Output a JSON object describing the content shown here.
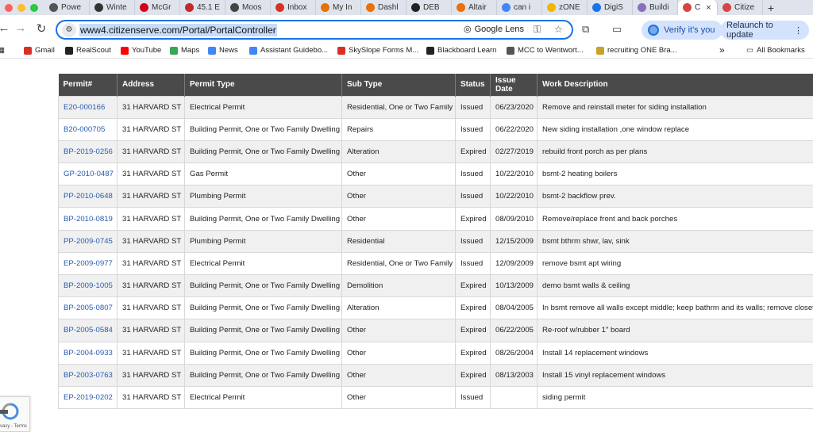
{
  "browser": {
    "tabs": [
      {
        "label": "Powe",
        "icon": "globe-icon",
        "color": "#555555"
      },
      {
        "label": "Winte",
        "icon": "s-icon",
        "color": "#333333"
      },
      {
        "label": "McGr",
        "icon": "mcgraw-icon",
        "color": "#d0021b"
      },
      {
        "label": "45.1 E",
        "icon": "red-badge-icon",
        "color": "#c62828"
      },
      {
        "label": "Moos",
        "icon": "moose-icon",
        "color": "#444444"
      },
      {
        "label": "Inbox",
        "icon": "gmail-icon",
        "color": "#d93025"
      },
      {
        "label": "My In",
        "icon": "rainbow-icon",
        "color": "#e8710a"
      },
      {
        "label": "Dashl",
        "icon": "rainbow-icon",
        "color": "#e8710a"
      },
      {
        "label": "DEB",
        "icon": "deb-icon",
        "color": "#222222"
      },
      {
        "label": "Altair",
        "icon": "rainbow-icon",
        "color": "#e8710a"
      },
      {
        "label": "can i",
        "icon": "google-icon",
        "color": "#4285f4"
      },
      {
        "label": "zONE",
        "icon": "zone-icon",
        "color": "#f4b400"
      },
      {
        "label": "DigiS",
        "icon": "digis-icon",
        "color": "#1a73e8"
      },
      {
        "label": "Buildi",
        "icon": "buildi-icon",
        "color": "#8a6fc0"
      },
      {
        "label": "C",
        "icon": "citizenserve-icon",
        "color": "#d64545",
        "active": true
      },
      {
        "label": "Citize",
        "icon": "citizenserve-icon",
        "color": "#d64545"
      }
    ],
    "new_tab": "+",
    "close_glyph": "×",
    "url": "www4.citizenserve.com/Portal/PortalController",
    "lens_label": "Google Lens",
    "verify_label": "Verify it's you",
    "relaunch_label": "Relaunch to update",
    "bookmarks": [
      {
        "label": "Gmail",
        "icon": "gmail-icon",
        "color": "#d93025"
      },
      {
        "label": "RealScout",
        "icon": "realscout-icon",
        "color": "#222222"
      },
      {
        "label": "YouTube",
        "icon": "youtube-icon",
        "color": "#ff0000"
      },
      {
        "label": "Maps",
        "icon": "maps-icon",
        "color": "#34a853"
      },
      {
        "label": "News",
        "icon": "news-icon",
        "color": "#4285f4"
      },
      {
        "label": "Assistant Guidebo...",
        "icon": "doc-icon",
        "color": "#4285f4"
      },
      {
        "label": "SkySlope Forms M...",
        "icon": "skyslope-icon",
        "color": "#d93025"
      },
      {
        "label": "Blackboard Learn",
        "icon": "blackboard-icon",
        "color": "#222222"
      },
      {
        "label": "MCC to Wentwort...",
        "icon": "globe-icon",
        "color": "#555555"
      },
      {
        "label": "recruiting ONE Bra...",
        "icon": "one-icon",
        "color": "#c9a227"
      }
    ],
    "more_glyph": "»",
    "all_bookmarks": "All Bookmarks"
  },
  "table": {
    "headers": [
      "Permit#",
      "Address",
      "Permit Type",
      "Sub Type",
      "Status",
      "Issue Date",
      "Work Description"
    ],
    "rows": [
      [
        "E20-000166",
        "31 HARVARD ST",
        "Electrical Permit",
        "Residential, One or Two Family",
        "Issued",
        "06/23/2020",
        "Remove and reinstall meter for siding installation"
      ],
      [
        "B20-000705",
        "31 HARVARD ST",
        "Building Permit, One or Two Family Dwelling",
        "Repairs",
        "Issued",
        "06/22/2020",
        "New siding installation ,one window replace"
      ],
      [
        "BP-2019-0256",
        "31 HARVARD ST",
        "Building Permit, One or Two Family Dwelling",
        "Alteration",
        "Expired",
        "02/27/2019",
        "rebuild front porch as per plans"
      ],
      [
        "GP-2010-0487",
        "31 HARVARD ST",
        "Gas Permit",
        "Other",
        "Issued",
        "10/22/2010",
        "bsmt-2 heating boilers"
      ],
      [
        "PP-2010-0648",
        "31 HARVARD ST",
        "Plumbing Permit",
        "Other",
        "Issued",
        "10/22/2010",
        "bsmt-2 backflow prev."
      ],
      [
        "BP-2010-0819",
        "31 HARVARD ST",
        "Building Permit, One or Two Family Dwelling",
        "Other",
        "Expired",
        "08/09/2010",
        "Remove/replace front and back porches"
      ],
      [
        "PP-2009-0745",
        "31 HARVARD ST",
        "Plumbing Permit",
        "Residential",
        "Issued",
        "12/15/2009",
        "bsmt bthrm shwr, lav, sink"
      ],
      [
        "EP-2009-0977",
        "31 HARVARD ST",
        "Electrical Permit",
        "Residential, One or Two Family",
        "Issued",
        "12/09/2009",
        "remove bsmt apt wiring"
      ],
      [
        "BP-2009-1005",
        "31 HARVARD ST",
        "Building Permit, One or Two Family Dwelling",
        "Demolition",
        "Expired",
        "10/13/2009",
        "demo bsmt walls & ceiling"
      ],
      [
        "BP-2005-0807",
        "31 HARVARD ST",
        "Building Permit, One or Two Family Dwelling",
        "Alteration",
        "Expired",
        "08/04/2005",
        "In bsmt remove all walls except middle; keep bathrm and its walls; remove closet"
      ],
      [
        "BP-2005-0584",
        "31 HARVARD ST",
        "Building Permit, One or Two Family Dwelling",
        "Other",
        "Expired",
        "06/22/2005",
        "Re-roof w/rubber 1\" board"
      ],
      [
        "BP-2004-0933",
        "31 HARVARD ST",
        "Building Permit, One or Two Family Dwelling",
        "Other",
        "Expired",
        "08/26/2004",
        "Install 14 replacement windows"
      ],
      [
        "BP-2003-0763",
        "31 HARVARD ST",
        "Building Permit, One or Two Family Dwelling",
        "Other",
        "Expired",
        "08/13/2003",
        "Install 15 vinyl replacement windows"
      ],
      [
        "EP-2019-0202",
        "31 HARVARD ST",
        "Electrical Permit",
        "Other",
        "Issued",
        "",
        "siding permit"
      ]
    ]
  },
  "recaptcha": {
    "text": "vacy - Terms"
  }
}
